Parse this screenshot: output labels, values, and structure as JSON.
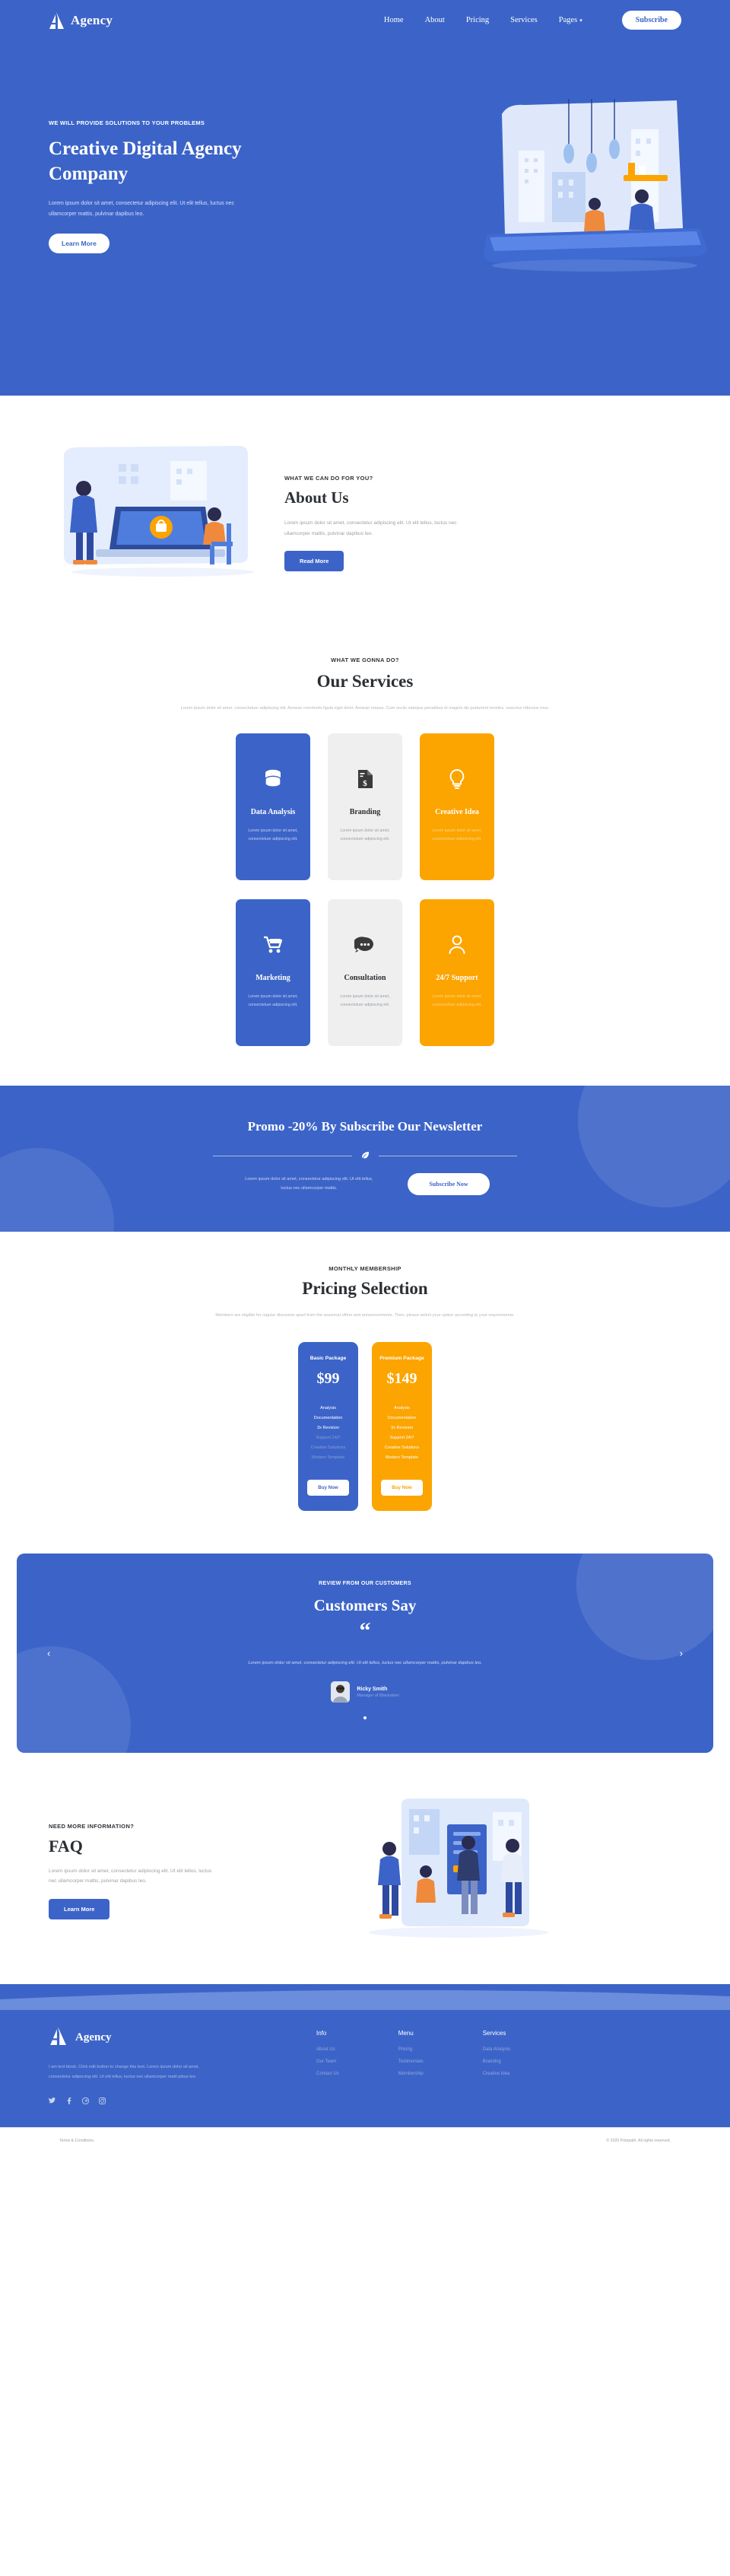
{
  "brand": {
    "name": "Agency",
    "logo_icon": "triangle-logo-icon"
  },
  "nav": {
    "links": [
      {
        "label": "Home"
      },
      {
        "label": "About"
      },
      {
        "label": "Pricing"
      },
      {
        "label": "Services"
      },
      {
        "label": "Pages",
        "caret": "▾"
      }
    ],
    "subscribe_label": "Subscribe"
  },
  "hero": {
    "kicker": "WE WILL PROVIDE SOLUTIONS TO YOUR PROBLEMS",
    "title": "Creative Digital Agency Company",
    "text": "Lorem ipsum dolor sit amet, consectetur adipiscing elit. Ut elit tellus, luctus nec ullamcorper mattis, pulvinar dapibus leo.",
    "cta_label": "Learn More"
  },
  "about": {
    "eyebrow": "WHAT WE CAN DO FOR YOU?",
    "title": "About Us",
    "text": "Lorem ipsum dolor sit amet, consectetur adipiscing elit. Ut elit tellus, luctus nec ullamcorper mattis, pulvinar dapibus leo.",
    "cta_label": "Read More"
  },
  "services": {
    "eyebrow": "WHAT WE GONNA DO?",
    "title": "Our Services",
    "subtitle": "Lorem ipsum dolor sit amet, consectetuer adipiscing elit. Aenean commodo ligula eget dolor. Aenean massa. Cum sociis natoque penatibus et magnis dis parturient montes, nascetur ridiculus mus.",
    "cards": [
      {
        "title": "Data Analysis",
        "text": "Lorem ipsum dolor sit amet, consectetuer adipiscing elit.",
        "style": "blue",
        "icon": "database-icon"
      },
      {
        "title": "Branding",
        "text": "Lorem ipsum dolor sit amet, consectetuer adipiscing elit.",
        "style": "grey",
        "icon": "invoice-dollar-icon"
      },
      {
        "title": "Creative Idea",
        "text": "Lorem ipsum dolor sit amet, consectetuer adipiscing elit.",
        "style": "amber",
        "icon": "lightbulb-icon"
      },
      {
        "title": "Marketing",
        "text": "Lorem ipsum dolor sit amet, consectetuer adipiscing elit.",
        "style": "blue",
        "icon": "shopping-cart-icon"
      },
      {
        "title": "Consultation",
        "text": "Lorem ipsum dolor sit amet, consectetuer adipiscing elit.",
        "style": "grey",
        "icon": "chat-bubble-icon"
      },
      {
        "title": "24/7 Support",
        "text": "Lorem ipsum dolor sit amet, consectetuer adipiscing elit.",
        "style": "amber",
        "icon": "user-icon"
      }
    ]
  },
  "promo": {
    "title": "Promo -20% By Subscribe Our Newsletter",
    "divider_icon": "leaf-icon",
    "text": "Lorem ipsum dolor sit amet, consectetur adipiscing elit. Ut elit tellus, luctus nec ullamcorper mattis.",
    "cta_label": "Subscribe Now"
  },
  "pricing": {
    "eyebrow": "MONTHLY MEMBERSHIP",
    "title": "Pricing Selection",
    "subtitle": "Members are eligible for regular discounts apart from the seasonal offers and announcements. Then, please select your option according to your requirements.",
    "plans": [
      {
        "name": "Basic Package",
        "price": "$99",
        "style": "blue",
        "cta_label": "Buy Now",
        "features": [
          {
            "label": "Analysis",
            "enabled": true
          },
          {
            "label": "Documentation",
            "enabled": true
          },
          {
            "label": "3x Revision",
            "enabled": true
          },
          {
            "label": "Support 24/7",
            "enabled": false
          },
          {
            "label": "Creative Solutions",
            "enabled": false
          },
          {
            "label": "Modern Template",
            "enabled": false
          }
        ]
      },
      {
        "name": "Premium Package",
        "price": "$149",
        "style": "amber",
        "cta_label": "Buy Now",
        "features": [
          {
            "label": "Analysis",
            "enabled": true
          },
          {
            "label": "Documentation",
            "enabled": true
          },
          {
            "label": "3x Revision",
            "enabled": true
          },
          {
            "label": "Support 24/7",
            "enabled": true
          },
          {
            "label": "Creative Solutions",
            "enabled": true
          },
          {
            "label": "Modern Template",
            "enabled": true
          }
        ]
      }
    ]
  },
  "testimonial": {
    "eyebrow": "REVIEW FROM OUR CUSTOMERS",
    "title": "Customers Say",
    "quote_mark": "“",
    "text": "Lorem ipsum dolor sit amet, consectetur adipiscing elit. Ut elit tellus, luctus nec ullamcorper mattis, pulvinar dapibus leo.",
    "person_name": "Ricky Smith",
    "person_role": "Manager of Blacksteel",
    "prev_icon": "chevron-left-icon",
    "next_icon": "chevron-right-icon"
  },
  "faq": {
    "eyebrow": "NEED MORE INFORMATION?",
    "title": "FAQ",
    "text": "Lorem ipsum dolor sit amet, consectetur adipiscing elit. Ut elit tellus, luctus nec ullamcorper mattis, pulvinar dapibus leo.",
    "cta_label": "Learn More"
  },
  "footer": {
    "brand_name": "Agency",
    "text": "I am text block. Click edit button to change this text. Lorem ipsum dolor sit amet, consectetur adipiscing elit. Ut elit tellus, luctus nec ullamcorper matti pibus leo.",
    "social": [
      {
        "icon": "twitter-icon",
        "glyph": "🐦"
      },
      {
        "icon": "facebook-icon",
        "glyph": "f"
      },
      {
        "icon": "pinterest-icon",
        "glyph": "ⓟ"
      },
      {
        "icon": "instagram-icon",
        "glyph": "▣"
      }
    ],
    "columns": [
      {
        "title": "Info",
        "links": [
          "About Us",
          "Our Team",
          "Contact Us"
        ]
      },
      {
        "title": "Menu",
        "links": [
          "Pricing",
          "Testimonials",
          "Membership"
        ]
      },
      {
        "title": "Services",
        "links": [
          "Data Analysis",
          "Branding",
          "Creative Idea"
        ]
      }
    ],
    "terms": "Terms & Conditions.",
    "copyright": "© 2020 Potopath. All rights reserved."
  },
  "colors": {
    "primary": "#3c64c8",
    "accent": "#fca400",
    "light": "#efefef"
  }
}
